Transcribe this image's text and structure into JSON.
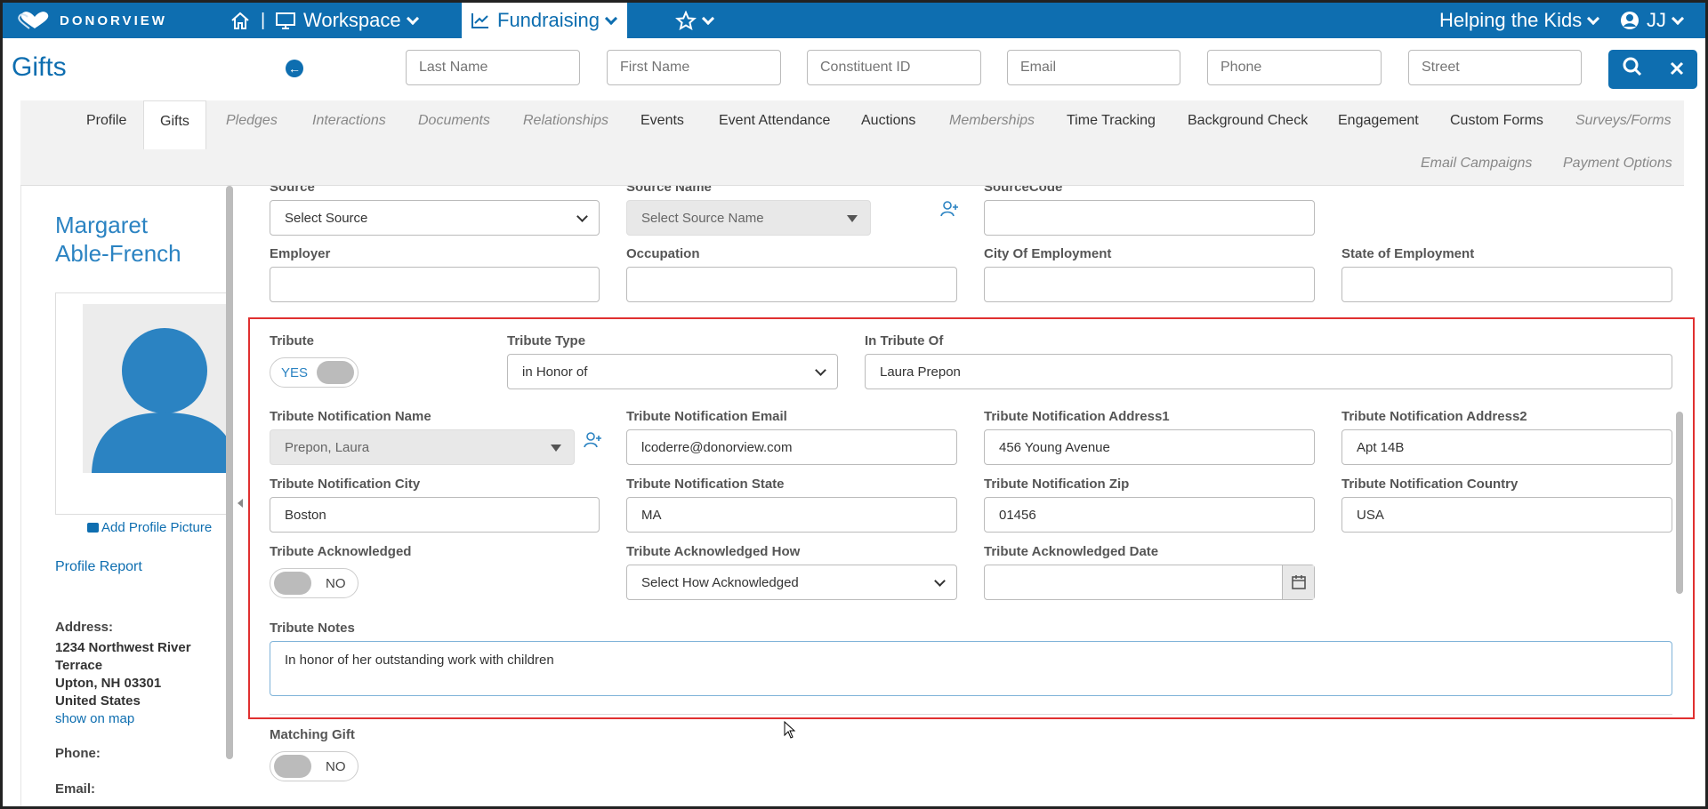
{
  "nav": {
    "brand": "DONORVIEW",
    "workspace": "Workspace",
    "fundraising": "Fundraising",
    "org": "Helping the Kids",
    "user": "JJ"
  },
  "page": {
    "title": "Gifts"
  },
  "search": {
    "last_name": "Last Name",
    "first_name": "First Name",
    "constituent_id": "Constituent ID",
    "email": "Email",
    "phone": "Phone",
    "street": "Street"
  },
  "tabs": [
    "Profile",
    "Gifts",
    "Pledges",
    "Interactions",
    "Documents",
    "Relationships",
    "Events",
    "Event Attendance",
    "Auctions",
    "Memberships",
    "Time Tracking",
    "Background Check",
    "Engagement",
    "Custom Forms",
    "Surveys/Forms",
    "Email Campaigns",
    "Payment Options"
  ],
  "donor": {
    "first": "Margaret",
    "last": "Able-French",
    "add_picture": "Add Profile Picture",
    "profile_report": "Profile Report",
    "address_label": "Address:",
    "address_line1": "1234 Northwest River",
    "address_line2": "Terrace",
    "address_line3": "Upton, NH 03301",
    "address_line4": "United States",
    "show_map": "show on map",
    "phone_label": "Phone:",
    "email_label": "Email:"
  },
  "form": {
    "source_label": "Source",
    "source_value": "Select Source",
    "source_name_label": "Source Name",
    "source_name_value": "Select Source Name",
    "source_code_label": "SourceCode",
    "employer_label": "Employer",
    "occupation_label": "Occupation",
    "city_employment_label": "City Of Employment",
    "state_employment_label": "State of Employment",
    "tribute_label": "Tribute",
    "tribute_toggle": "YES",
    "tribute_type_label": "Tribute Type",
    "tribute_type_value": "in Honor of",
    "in_tribute_of_label": "In Tribute Of",
    "in_tribute_of_value": "Laura Prepon",
    "notif_name_label": "Tribute Notification Name",
    "notif_name_value": "Prepon, Laura",
    "notif_email_label": "Tribute Notification Email",
    "notif_email_value": "lcoderre@donorview.com",
    "notif_addr1_label": "Tribute Notification Address1",
    "notif_addr1_value": "456 Young Avenue",
    "notif_addr2_label": "Tribute Notification Address2",
    "notif_addr2_value": "Apt 14B",
    "notif_city_label": "Tribute Notification City",
    "notif_city_value": "Boston",
    "notif_state_label": "Tribute Notification State",
    "notif_state_value": "MA",
    "notif_zip_label": "Tribute Notification Zip",
    "notif_zip_value": "01456",
    "notif_country_label": "Tribute Notification Country",
    "notif_country_value": "USA",
    "ack_label": "Tribute Acknowledged",
    "ack_toggle": "NO",
    "ack_how_label": "Tribute Acknowledged How",
    "ack_how_value": "Select How Acknowledged",
    "ack_date_label": "Tribute Acknowledged Date",
    "notes_label": "Tribute Notes",
    "notes_value": "In honor of her outstanding work with children",
    "matching_label": "Matching Gift",
    "matching_toggle": "NO"
  }
}
